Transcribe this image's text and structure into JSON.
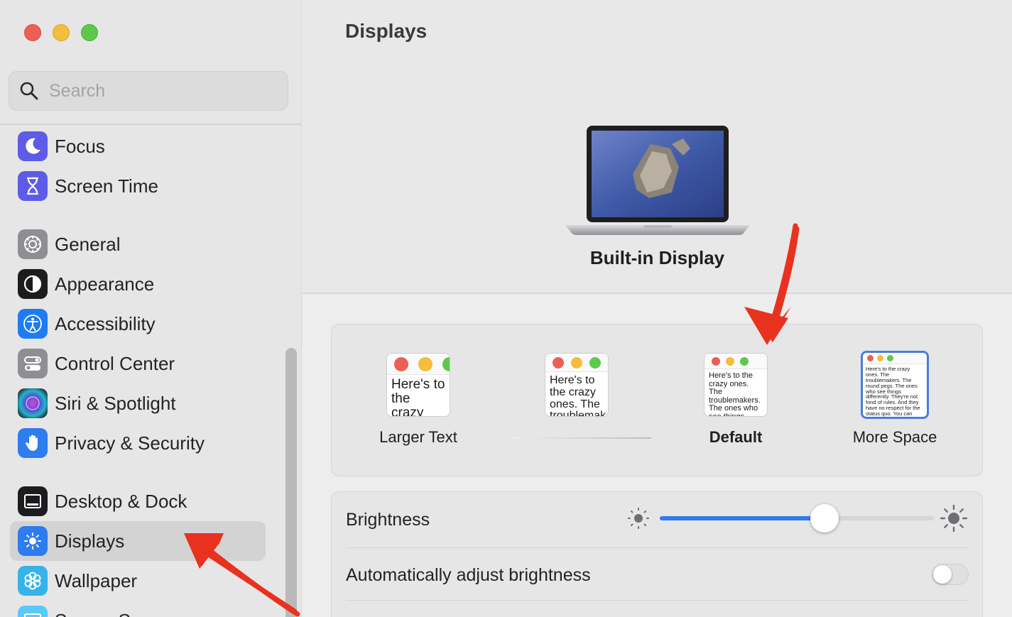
{
  "window": {
    "title": "Displays"
  },
  "search": {
    "placeholder": "Search"
  },
  "sidebar": {
    "items": [
      {
        "label": "Focus",
        "icon": "moon-icon",
        "color": "#5e5ce6"
      },
      {
        "label": "Screen Time",
        "icon": "hourglass-icon",
        "color": "#5e5ce6"
      },
      {
        "label": "General",
        "icon": "gear-icon",
        "color": "#8e8e93"
      },
      {
        "label": "Appearance",
        "icon": "appearance-icon",
        "color": "#1c1c1e"
      },
      {
        "label": "Accessibility",
        "icon": "accessibility-icon",
        "color": "#1e7cf2"
      },
      {
        "label": "Control Center",
        "icon": "toggles-icon",
        "color": "#8e8e93"
      },
      {
        "label": "Siri & Spotlight",
        "icon": "siri-icon",
        "color": "#2c2c3a"
      },
      {
        "label": "Privacy & Security",
        "icon": "hand-icon",
        "color": "#2f7bf0"
      },
      {
        "label": "Desktop & Dock",
        "icon": "dock-icon",
        "color": "#1c1c1e"
      },
      {
        "label": "Displays",
        "icon": "sun-icon",
        "color": "#2f7bf0",
        "selected": true
      },
      {
        "label": "Wallpaper",
        "icon": "flower-icon",
        "color": "#36b3e8"
      },
      {
        "label": "Screen Saver",
        "icon": "screen-saver-icon",
        "color": "#5ac8fa"
      }
    ]
  },
  "main": {
    "title": "Displays",
    "display_name": "Built-in Display",
    "resolution": {
      "options": [
        {
          "label": "Larger Text",
          "preview": "Here's to the crazy ones. The troublemakers."
        },
        {
          "label": "",
          "preview": "Here's to the crazy ones. The troublemakers. The ones who see things differently."
        },
        {
          "label": "Default",
          "preview": "Here's to the crazy ones. The troublemakers. The ones who see things differently. They're not fond of rules. And they have no respect.",
          "bold": true
        },
        {
          "label": "More Space",
          "preview": "Here's to the crazy ones. The troublemakers. The round pegs. The ones who see things differently. They're not fond of rules. And they have no respect for the status quo. You can quote them, disagree with them. About the only thing you can't do is ignore them. Because they change things.",
          "selected": true
        }
      ]
    },
    "brightness": {
      "label": "Brightness",
      "value": 0.6
    },
    "auto_brightness": {
      "label": "Automatically adjust brightness",
      "enabled": false
    }
  },
  "colors": {
    "accent": "#2f7bf0",
    "annotation": "#e8321f"
  }
}
